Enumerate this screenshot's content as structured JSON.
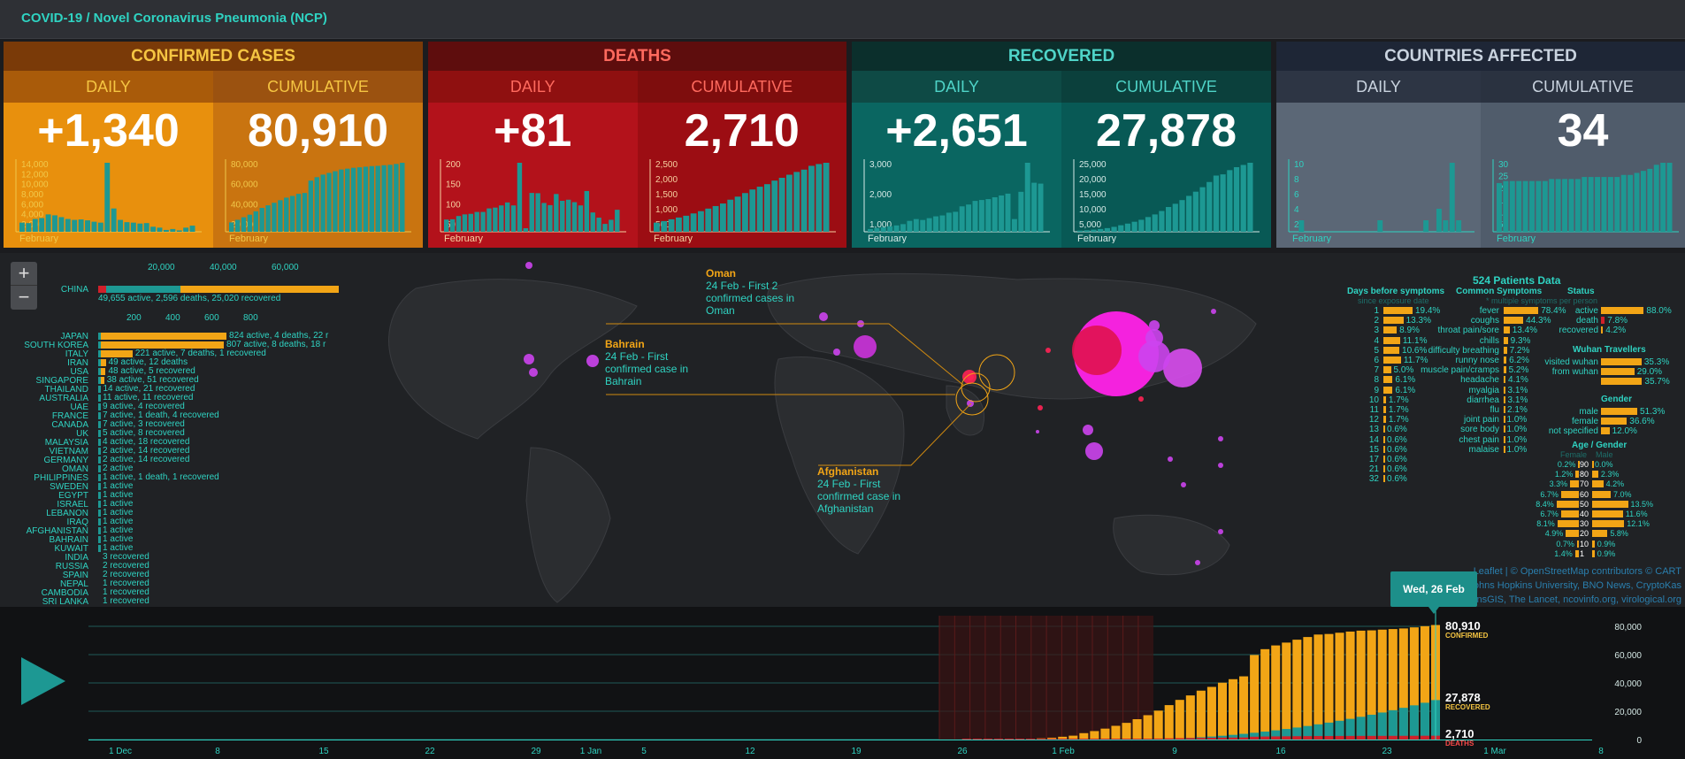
{
  "app": {
    "title": "COVID-19 / Novel Coronavirus Pneumonia (NCP)"
  },
  "cards": [
    {
      "key": "confirmed",
      "title": "CONFIRMED CASES",
      "daily_label": "DAILY",
      "cum_label": "CUMULATIVE",
      "daily": "+1,340",
      "cumulative": "80,910",
      "colors": {
        "head": "#7a3a08",
        "title": "#f5c542",
        "subL": "#a95b0a",
        "subR": "#9b5210",
        "bodyL": "#e8900d",
        "bodyR": "#c97410",
        "bars": "#1d9893",
        "tick": "#f0c84a"
      },
      "daily_axis": [
        "14,000",
        "12,000",
        "10,000",
        "8,000",
        "6,000",
        "4,000",
        "2,000"
      ],
      "cum_axis": [
        "80,000",
        "60,000",
        "40,000",
        "20,000"
      ],
      "month": "February"
    },
    {
      "key": "deaths",
      "title": "DEATHS",
      "daily_label": "DAILY",
      "cum_label": "CUMULATIVE",
      "daily": "+81",
      "cumulative": "2,710",
      "colors": {
        "head": "#5e0d0d",
        "title": "#ff6a5e",
        "subL": "#8f1010",
        "subR": "#7e0d0d",
        "bodyL": "#b3121b",
        "bodyR": "#9c0d13",
        "bars": "#1d9893",
        "tick": "#f6d1a0"
      },
      "daily_axis": [
        "200",
        "150",
        "100",
        "50"
      ],
      "cum_axis": [
        "2,500",
        "2,000",
        "1,500",
        "1,000",
        "500"
      ],
      "month": "February"
    },
    {
      "key": "recovered",
      "title": "RECOVERED",
      "daily_label": "DAILY",
      "cum_label": "CUMULATIVE",
      "daily": "+2,651",
      "cumulative": "27,878",
      "colors": {
        "head": "#0b2f2c",
        "title": "#4fd4c8",
        "subL": "#0e4a45",
        "subR": "#0b403c",
        "bodyL": "#0a6661",
        "bodyR": "#085955",
        "bars": "#1d9893",
        "tick": "#d6e9e6"
      },
      "daily_axis": [
        "3,000",
        "2,000",
        "1,000"
      ],
      "cum_axis": [
        "25,000",
        "20,000",
        "15,000",
        "10,000",
        "5,000"
      ],
      "month": "February"
    },
    {
      "key": "countries",
      "title": "COUNTRIES AFFECTED",
      "daily_label": "DAILY",
      "cum_label": "CUMULATIVE",
      "daily": "",
      "cumulative": "34",
      "colors": {
        "head": "#1e2636",
        "title": "#c9d3df",
        "subL": "#2d3544",
        "subR": "#2a3240",
        "bodyL": "#5b6776",
        "bodyR": "#505c6b",
        "bars": "#1d9893",
        "tick": "#2fd3c2"
      },
      "daily_axis": [
        "10",
        "8",
        "6",
        "4",
        "2"
      ],
      "cum_axis": [
        "30",
        "25",
        "20",
        "15",
        "10",
        "5"
      ],
      "month": "February"
    }
  ],
  "map": {
    "zoom_in": "+",
    "zoom_out": "−",
    "china": {
      "name": "CHINA",
      "axis": [
        "20,000",
        "40,000",
        "60,000"
      ],
      "text": "49,655 active, 2,596 deaths, 25,020 recovered"
    },
    "countries_axis": [
      "200",
      "400",
      "600",
      "800"
    ],
    "countries": [
      {
        "name": "JAPAN",
        "active": 824,
        "text": "824 active, 4 deaths, 22 r"
      },
      {
        "name": "SOUTH KOREA",
        "active": 807,
        "text": "807 active, 8 deaths, 18 r"
      },
      {
        "name": "ITALY",
        "active": 221,
        "text": "221 active, 7 deaths, 1 recovered"
      },
      {
        "name": "IRAN",
        "active": 49,
        "text": "49 active, 12 deaths"
      },
      {
        "name": "USA",
        "active": 48,
        "text": "48 active, 5 recovered"
      },
      {
        "name": "SINGAPORE",
        "active": 38,
        "text": "38 active, 51 recovered"
      },
      {
        "name": "THAILAND",
        "active": 14,
        "text": "14 active, 21 recovered"
      },
      {
        "name": "AUSTRALIA",
        "active": 11,
        "text": "11 active, 11 recovered"
      },
      {
        "name": "UAE",
        "active": 9,
        "text": "9 active, 4 recovered"
      },
      {
        "name": "FRANCE",
        "active": 7,
        "text": "7 active, 1 death, 4 recovered"
      },
      {
        "name": "CANADA",
        "active": 7,
        "text": "7 active, 3 recovered"
      },
      {
        "name": "UK",
        "active": 5,
        "text": "5 active, 8 recovered"
      },
      {
        "name": "MALAYSIA",
        "active": 4,
        "text": "4 active, 18 recovered"
      },
      {
        "name": "VIETNAM",
        "active": 2,
        "text": "2 active, 14 recovered"
      },
      {
        "name": "GERMANY",
        "active": 2,
        "text": "2 active, 14 recovered"
      },
      {
        "name": "OMAN",
        "active": 2,
        "text": "2 active"
      },
      {
        "name": "PHILIPPINES",
        "active": 1,
        "text": "1 active, 1 death, 1 recovered"
      },
      {
        "name": "SWEDEN",
        "active": 1,
        "text": "1 active"
      },
      {
        "name": "EGYPT",
        "active": 1,
        "text": "1 active"
      },
      {
        "name": "ISRAEL",
        "active": 1,
        "text": "1 active"
      },
      {
        "name": "LEBANON",
        "active": 1,
        "text": "1 active"
      },
      {
        "name": "IRAQ",
        "active": 1,
        "text": "1 active"
      },
      {
        "name": "AFGHANISTAN",
        "active": 1,
        "text": "1 active"
      },
      {
        "name": "BAHRAIN",
        "active": 1,
        "text": "1 active"
      },
      {
        "name": "KUWAIT",
        "active": 1,
        "text": "1 active"
      },
      {
        "name": "INDIA",
        "active": 0,
        "text": "3 recovered"
      },
      {
        "name": "RUSSIA",
        "active": 0,
        "text": "2 recovered"
      },
      {
        "name": "SPAIN",
        "active": 0,
        "text": "2 recovered"
      },
      {
        "name": "NEPAL",
        "active": 0,
        "text": "1 recovered"
      },
      {
        "name": "CAMBODIA",
        "active": 0,
        "text": "1 recovered"
      },
      {
        "name": "SRI LANKA",
        "active": 0,
        "text": "1 recovered"
      }
    ],
    "annotations": [
      {
        "place": "Oman",
        "text": [
          "24 Feb - First 2",
          "confirmed cases in",
          "Oman"
        ]
      },
      {
        "place": "Bahrain",
        "text": [
          "24 Feb - First",
          "confirmed case in",
          "Bahrain"
        ]
      },
      {
        "place": "Afghanistan",
        "text": [
          "24 Feb - First",
          "confirmed case in",
          "Afghanistan"
        ]
      }
    ],
    "patients": {
      "title": "524  Patients Data",
      "days_title": "Days before symptoms",
      "days_sub": "since exposure date",
      "symptoms_title": "Common Symptoms",
      "symptoms_sub": "* multiple symptoms per person",
      "status_title": "Status",
      "days": [
        {
          "d": "1",
          "v": "19.4%"
        },
        {
          "d": "2",
          "v": "13.3%"
        },
        {
          "d": "3",
          "v": "8.9%"
        },
        {
          "d": "4",
          "v": "11.1%"
        },
        {
          "d": "5",
          "v": "10.6%"
        },
        {
          "d": "6",
          "v": "11.7%"
        },
        {
          "d": "7",
          "v": "5.0%"
        },
        {
          "d": "8",
          "v": "6.1%"
        },
        {
          "d": "9",
          "v": "6.1%"
        },
        {
          "d": "10",
          "v": "1.7%"
        },
        {
          "d": "11",
          "v": "1.7%"
        },
        {
          "d": "12",
          "v": "1.7%"
        },
        {
          "d": "13",
          "v": "0.6%"
        },
        {
          "d": "14",
          "v": "0.6%"
        },
        {
          "d": "15",
          "v": "0.6%"
        },
        {
          "d": "17",
          "v": "0.6%"
        },
        {
          "d": "21",
          "v": "0.6%"
        },
        {
          "d": "32",
          "v": "0.6%"
        }
      ],
      "symptoms": [
        {
          "s": "fever",
          "v": "78.4%"
        },
        {
          "s": "coughs",
          "v": "44.3%"
        },
        {
          "s": "throat pain/sore",
          "v": "13.4%"
        },
        {
          "s": "chills",
          "v": "9.3%"
        },
        {
          "s": "difficulty breathing",
          "v": "7.2%"
        },
        {
          "s": "runny nose",
          "v": "6.2%"
        },
        {
          "s": "muscle pain/cramps",
          "v": "5.2%"
        },
        {
          "s": "headache",
          "v": "4.1%"
        },
        {
          "s": "myalgia",
          "v": "3.1%"
        },
        {
          "s": "diarrhea",
          "v": "3.1%"
        },
        {
          "s": "flu",
          "v": "2.1%"
        },
        {
          "s": "joint pain",
          "v": "1.0%"
        },
        {
          "s": "sore body",
          "v": "1.0%"
        },
        {
          "s": "chest pain",
          "v": "1.0%"
        },
        {
          "s": "malaise",
          "v": "1.0%"
        }
      ],
      "status": [
        {
          "s": "active",
          "v": "88.0%"
        },
        {
          "s": "death",
          "v": "7.8%"
        },
        {
          "s": "recovered",
          "v": "4.2%"
        }
      ],
      "wuhan_title": "Wuhan Travellers",
      "wuhan": [
        {
          "s": "visited wuhan",
          "v": "35.3%"
        },
        {
          "s": "from wuhan",
          "v": "29.0%"
        },
        {
          "s": "",
          "v": "35.7%"
        }
      ],
      "gender_title": "Gender",
      "gender": [
        {
          "s": "male",
          "v": "51.3%"
        },
        {
          "s": "female",
          "v": "36.6%"
        },
        {
          "s": "not specified",
          "v": "12.0%"
        }
      ],
      "age_title": "Age / Gender",
      "female_label": "Female",
      "male_label": "Male",
      "age": [
        {
          "a": "90",
          "f": "0.2%",
          "m": "0.0%"
        },
        {
          "a": "80",
          "f": "1.2%",
          "m": "2.3%"
        },
        {
          "a": "70",
          "f": "3.3%",
          "m": "4.2%"
        },
        {
          "a": "60",
          "f": "6.7%",
          "m": "7.0%"
        },
        {
          "a": "50",
          "f": "8.4%",
          "m": "13.5%"
        },
        {
          "a": "40",
          "f": "6.7%",
          "m": "11.6%"
        },
        {
          "a": "30",
          "f": "8.1%",
          "m": "12.1%"
        },
        {
          "a": "20",
          "f": "4.9%",
          "m": "5.8%"
        },
        {
          "a": "10",
          "f": "0.7%",
          "m": "0.9%"
        },
        {
          "a": "1",
          "f": "1.4%",
          "m": "0.9%"
        }
      ]
    },
    "attribution": [
      "Leaflet | © OpenStreetMap contributors © CART",
      "ohns Hopkins University, BNO News, CryptoKas",
      "nsGIS, The Lancet, ncovinfo.org, virological.org"
    ]
  },
  "timeline": {
    "play_icon": "play-icon",
    "tooltip": "Wed, 26 Feb",
    "confirmed_value": "80,910",
    "confirmed_label": "CONFIRMED",
    "recovered_value": "27,878",
    "recovered_label": "RECOVERED",
    "deaths_value": "2,710",
    "deaths_label": "DEATHS",
    "x_labels": [
      "1 Dec",
      "8",
      "15",
      "22",
      "29",
      "1 Jan",
      "5",
      "12",
      "19",
      "26",
      "1 Feb",
      "9",
      "16",
      "23",
      "1 Mar",
      "8"
    ],
    "y_labels": [
      "80,000",
      "60,000",
      "40,000",
      "20,000",
      "0"
    ]
  },
  "chart_data": [
    {
      "type": "bar",
      "title": "CONFIRMED CASES",
      "xlabel": "February",
      "series": [
        {
          "name": "DAILY",
          "values": [
            2000,
            1900,
            2800,
            3000,
            3800,
            3600,
            3200,
            2800,
            2600,
            2700,
            2500,
            2200,
            2000,
            15100,
            5100,
            2600,
            2100,
            2000,
            1800,
            1900,
            1100,
            900,
            400,
            600,
            300,
            900,
            1340
          ]
        },
        {
          "name": "CUMULATIVE",
          "values": [
            11000,
            14000,
            17000,
            20000,
            24000,
            28000,
            31000,
            34000,
            37000,
            40000,
            42000,
            44500,
            45500,
            60000,
            64000,
            67000,
            69000,
            71000,
            73000,
            74000,
            75000,
            75600,
            76300,
            77000,
            77300,
            78000,
            78500,
            79500,
            80910
          ]
        }
      ]
    },
    {
      "type": "bar",
      "title": "DEATHS",
      "xlabel": "February",
      "series": [
        {
          "name": "DAILY",
          "values": [
            45,
            46,
            58,
            64,
            66,
            73,
            73,
            86,
            89,
            97,
            108,
            97,
            254,
            13,
            143,
            142,
            106,
            98,
            139,
            114,
            118,
            109,
            97,
            150,
            71,
            52,
            29,
            44,
            81
          ]
        },
        {
          "name": "CUMULATIVE",
          "values": [
            360,
            420,
            490,
            560,
            630,
            720,
            810,
            910,
            1010,
            1110,
            1260,
            1380,
            1520,
            1660,
            1770,
            1870,
            2010,
            2120,
            2240,
            2350,
            2440,
            2590,
            2660,
            2710
          ]
        }
      ]
    },
    {
      "type": "bar",
      "title": "RECOVERED",
      "xlabel": "February",
      "series": [
        {
          "name": "DAILY",
          "values": [
            150,
            200,
            250,
            300,
            350,
            420,
            600,
            700,
            650,
            750,
            850,
            900,
            1050,
            1100,
            1400,
            1500,
            1700,
            1750,
            1800,
            1900,
            2000,
            2100,
            700,
            2200,
            3800,
            2700,
            2651
          ]
        },
        {
          "name": "CUMULATIVE",
          "values": [
            470,
            620,
            840,
            1120,
            1480,
            1990,
            2630,
            3300,
            4050,
            4840,
            5950,
            7000,
            8400,
            10000,
            11300,
            12800,
            14500,
            16200,
            18000,
            20100,
            22700,
            23200,
            24900,
            26100,
            27000,
            27878
          ]
        }
      ]
    },
    {
      "type": "bar",
      "title": "COUNTRIES AFFECTED",
      "xlabel": "February",
      "series": [
        {
          "name": "DAILY",
          "values": [
            0,
            1,
            0,
            0,
            0,
            0,
            0,
            0,
            0,
            0,
            0,
            0,
            0,
            1,
            0,
            0,
            0,
            0,
            0,
            0,
            1,
            0,
            2,
            1,
            6,
            1,
            0
          ]
        },
        {
          "name": "CUMULATIVE",
          "values": [
            24,
            25,
            25,
            25,
            25,
            25,
            25,
            25,
            26,
            26,
            26,
            26,
            26,
            27,
            27,
            27,
            27,
            27,
            27,
            28,
            28,
            29,
            30,
            31,
            33,
            34,
            34
          ]
        }
      ]
    },
    {
      "type": "bar",
      "title": "",
      "xlabel": "",
      "ylabel": "",
      "ylim": [
        0,
        80000
      ],
      "categories_count": 52,
      "series": [
        {
          "name": "CONFIRMED",
          "values": [
            0,
            0,
            0,
            0,
            0,
            0,
            0,
            0,
            0,
            0,
            0,
            0,
            0,
            0,
            0,
            0,
            0,
            0,
            0,
            0,
            0,
            0,
            0,
            0,
            45,
            62,
            121,
            198,
            291,
            440,
            571,
            830,
            1287,
            1975,
            2744,
            4515,
            5974,
            7711,
            9692,
            11791,
            14380,
            17205,
            20438,
            24324,
            28018,
            31161,
            34546,
            37198,
            40171,
            42638,
            44653,
            59738,
            63851,
            66492,
            68500,
            70548,
            72436,
            74185,
            74576,
            75465,
            76288,
            76936,
            77150,
            77658,
            78064,
            78497,
            79250,
            80088,
            80910
          ]
        },
        {
          "name": "RECOVERED",
          "values": [
            0,
            0,
            0,
            0,
            0,
            0,
            0,
            0,
            0,
            0,
            0,
            0,
            0,
            0,
            0,
            0,
            0,
            0,
            0,
            0,
            0,
            0,
            0,
            0,
            0,
            0,
            0,
            0,
            0,
            0,
            0,
            0,
            0,
            0,
            0,
            0,
            0,
            0,
            0,
            0,
            0,
            0,
            0,
            0,
            0,
            0,
            0,
            0,
            0,
            0,
            0,
            0,
            0,
            0,
            0,
            0,
            0,
            0,
            0,
            0,
            0,
            0,
            0,
            0,
            0,
            0,
            0,
            0,
            27878
          ]
        },
        {
          "name": "DEATHS",
          "values": [
            2710
          ]
        }
      ]
    }
  ]
}
